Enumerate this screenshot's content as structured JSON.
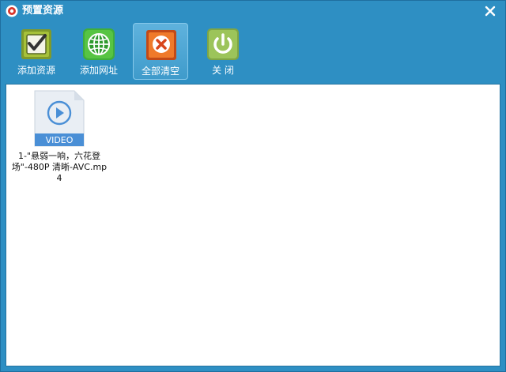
{
  "window": {
    "title": "预置资源"
  },
  "toolbar": {
    "items": [
      {
        "label": "添加资源",
        "icon": "check-box-icon",
        "active": false
      },
      {
        "label": "添加网址",
        "icon": "globe-icon",
        "active": false
      },
      {
        "label": "全部清空",
        "icon": "clear-x-icon",
        "active": true
      },
      {
        "label": "关  闭",
        "icon": "power-icon",
        "active": false
      }
    ]
  },
  "files": [
    {
      "name": "1-\"悬弱一响，六花登场\"-480P 清晰-AVC.mp4",
      "type_label": "VIDEO",
      "icon": "video-file-icon"
    }
  ],
  "colors": {
    "window_bg": "#2e8fc3",
    "content_bg": "#ffffff",
    "video_badge": "#4a8fd6"
  }
}
